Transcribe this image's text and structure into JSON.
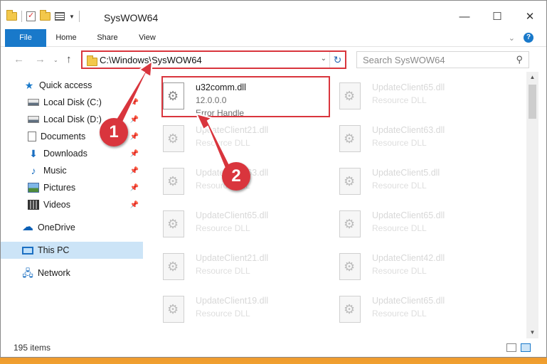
{
  "window": {
    "title": "SysWOW64",
    "buttons": {
      "minimize": "—",
      "maximize": "☐",
      "close": "✕"
    }
  },
  "ribbon": {
    "tabs": [
      {
        "label": "File"
      },
      {
        "label": "Home"
      },
      {
        "label": "Share"
      },
      {
        "label": "View"
      }
    ],
    "help_label": "?"
  },
  "addressbar": {
    "path": "C:\\Windows\\SysWOW64",
    "search_placeholder": "Search SysWOW64"
  },
  "navpane": {
    "items": [
      {
        "label": "Quick access",
        "icon": "star-icon",
        "pinned": false
      },
      {
        "label": "Local Disk (C:)",
        "icon": "disk-icon",
        "pinned": true
      },
      {
        "label": "Local Disk (D:)",
        "icon": "disk-icon",
        "pinned": true
      },
      {
        "label": "Documents",
        "icon": "documents-icon",
        "pinned": true
      },
      {
        "label": "Downloads",
        "icon": "downloads-icon",
        "pinned": true
      },
      {
        "label": "Music",
        "icon": "music-icon",
        "pinned": true
      },
      {
        "label": "Pictures",
        "icon": "pictures-icon",
        "pinned": true
      },
      {
        "label": "Videos",
        "icon": "videos-icon",
        "pinned": true
      },
      {
        "label": "OneDrive",
        "icon": "onedrive-icon",
        "pinned": false
      },
      {
        "label": "This PC",
        "icon": "this-pc-icon",
        "pinned": false,
        "selected": true
      },
      {
        "label": "Network",
        "icon": "network-icon",
        "pinned": false
      }
    ]
  },
  "files": {
    "highlighted": {
      "name": "u32comm.dll",
      "version": "12.0.0.0",
      "description": "Error Handle"
    },
    "faded_left": [
      {
        "name": "UpdateClient21.dll",
        "type": "Resource DLL"
      },
      {
        "name": "UpdateClient63.dll",
        "type": "Resource DLL"
      },
      {
        "name": "UpdateClient65.dll",
        "type": "Resource DLL"
      },
      {
        "name": "UpdateClient21.dll",
        "type": "Resource DLL"
      },
      {
        "name": "UpdateClient19.dll",
        "type": "Resource DLL"
      }
    ],
    "faded_right": [
      {
        "name": "UpdateClient65.dll",
        "type": "Resource DLL"
      },
      {
        "name": "UpdateClient63.dll",
        "type": "Resource DLL"
      },
      {
        "name": "UpdateClient5.dll",
        "type": "Resource DLL"
      },
      {
        "name": "UpdateClient65.dll",
        "type": "Resource DLL"
      },
      {
        "name": "UpdateClient42.dll",
        "type": "Resource DLL"
      },
      {
        "name": "UpdateClient65.dll",
        "type": "Resource DLL"
      }
    ]
  },
  "status": {
    "item_count": "195 items"
  },
  "annotations": {
    "step1": "1",
    "step2": "2",
    "color": "#d9353d"
  }
}
